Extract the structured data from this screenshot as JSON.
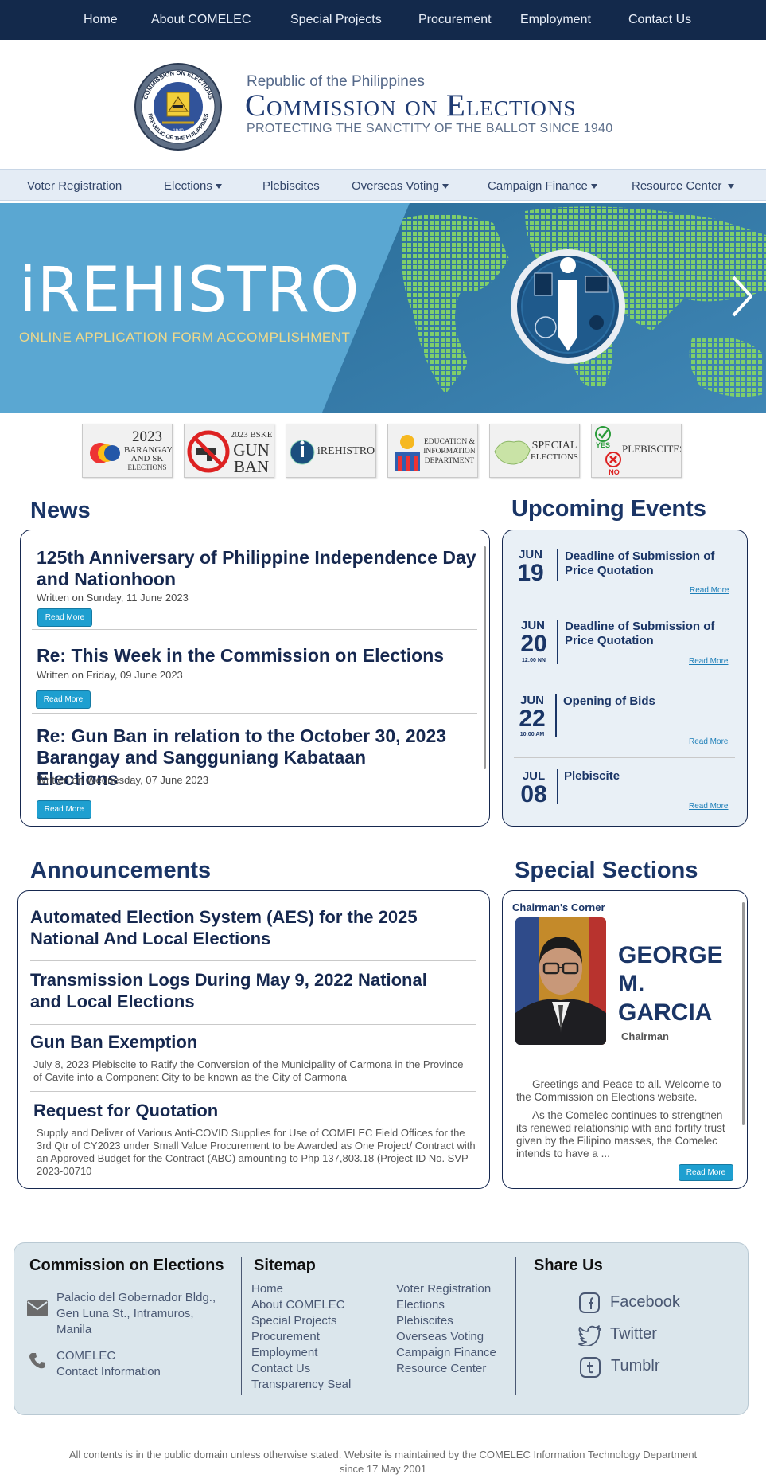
{
  "topnav": {
    "items": [
      "Home",
      "About COMELEC",
      "Special Projects",
      "Procurement",
      "Employment",
      "Contact Us"
    ]
  },
  "header": {
    "republic": "Republic of the Philippines",
    "title": "Commission on Elections",
    "tagline": "PROTECTING THE SANCTITY OF THE BALLOT SINCE 1940",
    "seal_top_text": "COMMISSION ON ELECTIONS",
    "seal_bottom_text": "REPUBLIC OF THE PHILIPPINES",
    "seal_year": "1940"
  },
  "subnav": {
    "items": [
      "Voter Registration",
      "Elections",
      "Plebiscites",
      "Overseas Voting",
      "Campaign Finance",
      "Resource Center"
    ]
  },
  "hero": {
    "title": "iREHISTRO",
    "subtitle": "ONLINE APPLICATION FORM ACCOMPLISHMENT"
  },
  "quick_links": [
    {
      "line1": "2023",
      "line2": "BARANGAY",
      "line3": "AND SK",
      "line4": "ELECTIONS"
    },
    {
      "line1": "2023 BSKE",
      "line2": "GUN",
      "line3": "BAN"
    },
    {
      "line1": "iREHISTRO"
    },
    {
      "line1": "EDUCATION &",
      "line2": "INFORMATION",
      "line3": "DEPARTMENT"
    },
    {
      "line1": "SPECIAL",
      "line2": "ELECTIONS"
    },
    {
      "line1": "YES",
      "line2": "NO",
      "line3": "PLEBISCITES"
    }
  ],
  "news": {
    "heading": "News",
    "items": [
      {
        "title": "125th Anniversary of Philippine Independence Day and Nationhoon",
        "date": "Written on Sunday, 11 June 2023",
        "button": "Read More"
      },
      {
        "title": "Re: This Week in the Commission on Elections",
        "date": "Written on Friday, 09 June 2023",
        "button": "Read More"
      },
      {
        "title": "Re: Gun Ban in relation to the October 30, 2023 Barangay and Sangguniang Kabataan Elections",
        "date": "Written on Wednesday, 07 June 2023",
        "button": "Read More"
      }
    ]
  },
  "events": {
    "heading": "Upcoming Events",
    "items": [
      {
        "month": "JUN",
        "day": "19",
        "time": "",
        "title": "Deadline of Submission of Price Quotation",
        "link": "Read More"
      },
      {
        "month": "JUN",
        "day": "20",
        "time": "12:00 NN",
        "title": "Deadline of Submission of Price Quotation",
        "link": "Read More"
      },
      {
        "month": "JUN",
        "day": "22",
        "time": "10:00 AM",
        "title": "Opening of Bids",
        "link": "Read More"
      },
      {
        "month": "JUL",
        "day": "08",
        "time": "",
        "title": "Plebiscite",
        "link": "Read More"
      }
    ]
  },
  "announcements": {
    "heading": "Announcements",
    "items": [
      {
        "title": "Automated Election System (AES) for the 2025 National And Local Elections",
        "desc": ""
      },
      {
        "title": "Transmission Logs During May 9, 2022 National and Local Elections",
        "desc": ""
      },
      {
        "title": "Gun Ban Exemption",
        "desc": "July 8, 2023 Plebiscite to Ratify the Conversion of the Municipality of Carmona in the Province of Cavite into a Component City to be known as the City of Carmona"
      },
      {
        "title": "Request for Quotation",
        "desc": "Supply and Deliver of Various Anti-COVID Supplies for Use of COMELEC Field Offices for the 3rd Qtr of CY2023 under Small Value Procurement to be Awarded as One Project/ Contract with an Approved Budget for the Contract (ABC) amounting to Php 137,803.18 (Project ID No. SVP 2023-00710"
      }
    ]
  },
  "special": {
    "heading": "Special Sections",
    "corner_label": "Chairman's Corner",
    "name_line1": "GEORGE",
    "name_line2": "M.",
    "name_line3": "GARCIA",
    "role": "Chairman",
    "para1": "Greetings and Peace to all. Welcome to the Commission on Elections website.",
    "para2": "As the Comelec continues to strengthen its renewed relationship with and fortify trust given by the Filipino masses, the Comelec intends to have a ...",
    "button": "Read More"
  },
  "footer": {
    "org_heading": "Commission on Elections",
    "address_line1": "Palacio del Gobernador Bldg.,",
    "address_line2": "Gen Luna St., Intramuros,",
    "address_line3": "Manila",
    "contact_line1": "COMELEC",
    "contact_line2": "Contact Information",
    "sitemap_heading": "Sitemap",
    "sitemap_col1": [
      "Home",
      "About COMELEC",
      "Special Projects",
      "Procurement",
      "Employment",
      "Contact Us",
      "Transparency Seal"
    ],
    "sitemap_col2": [
      "Voter Registration",
      "Elections",
      "Plebiscites",
      "Overseas Voting",
      "Campaign Finance",
      "Resource Center"
    ],
    "share_heading": "Share Us",
    "share": [
      "Facebook",
      "Twitter",
      "Tumblr"
    ],
    "copyright_line1": "All contents is in the public domain unless otherwise stated. Website is maintained by the COMELEC Information Technology Department",
    "copyright_line2": "since 17 May 2001"
  },
  "colors": {
    "navy": "#13294b",
    "accent_blue": "#1e9fd0",
    "hero_blue": "#5aa7d2",
    "map_green": "#7fcf6a"
  }
}
